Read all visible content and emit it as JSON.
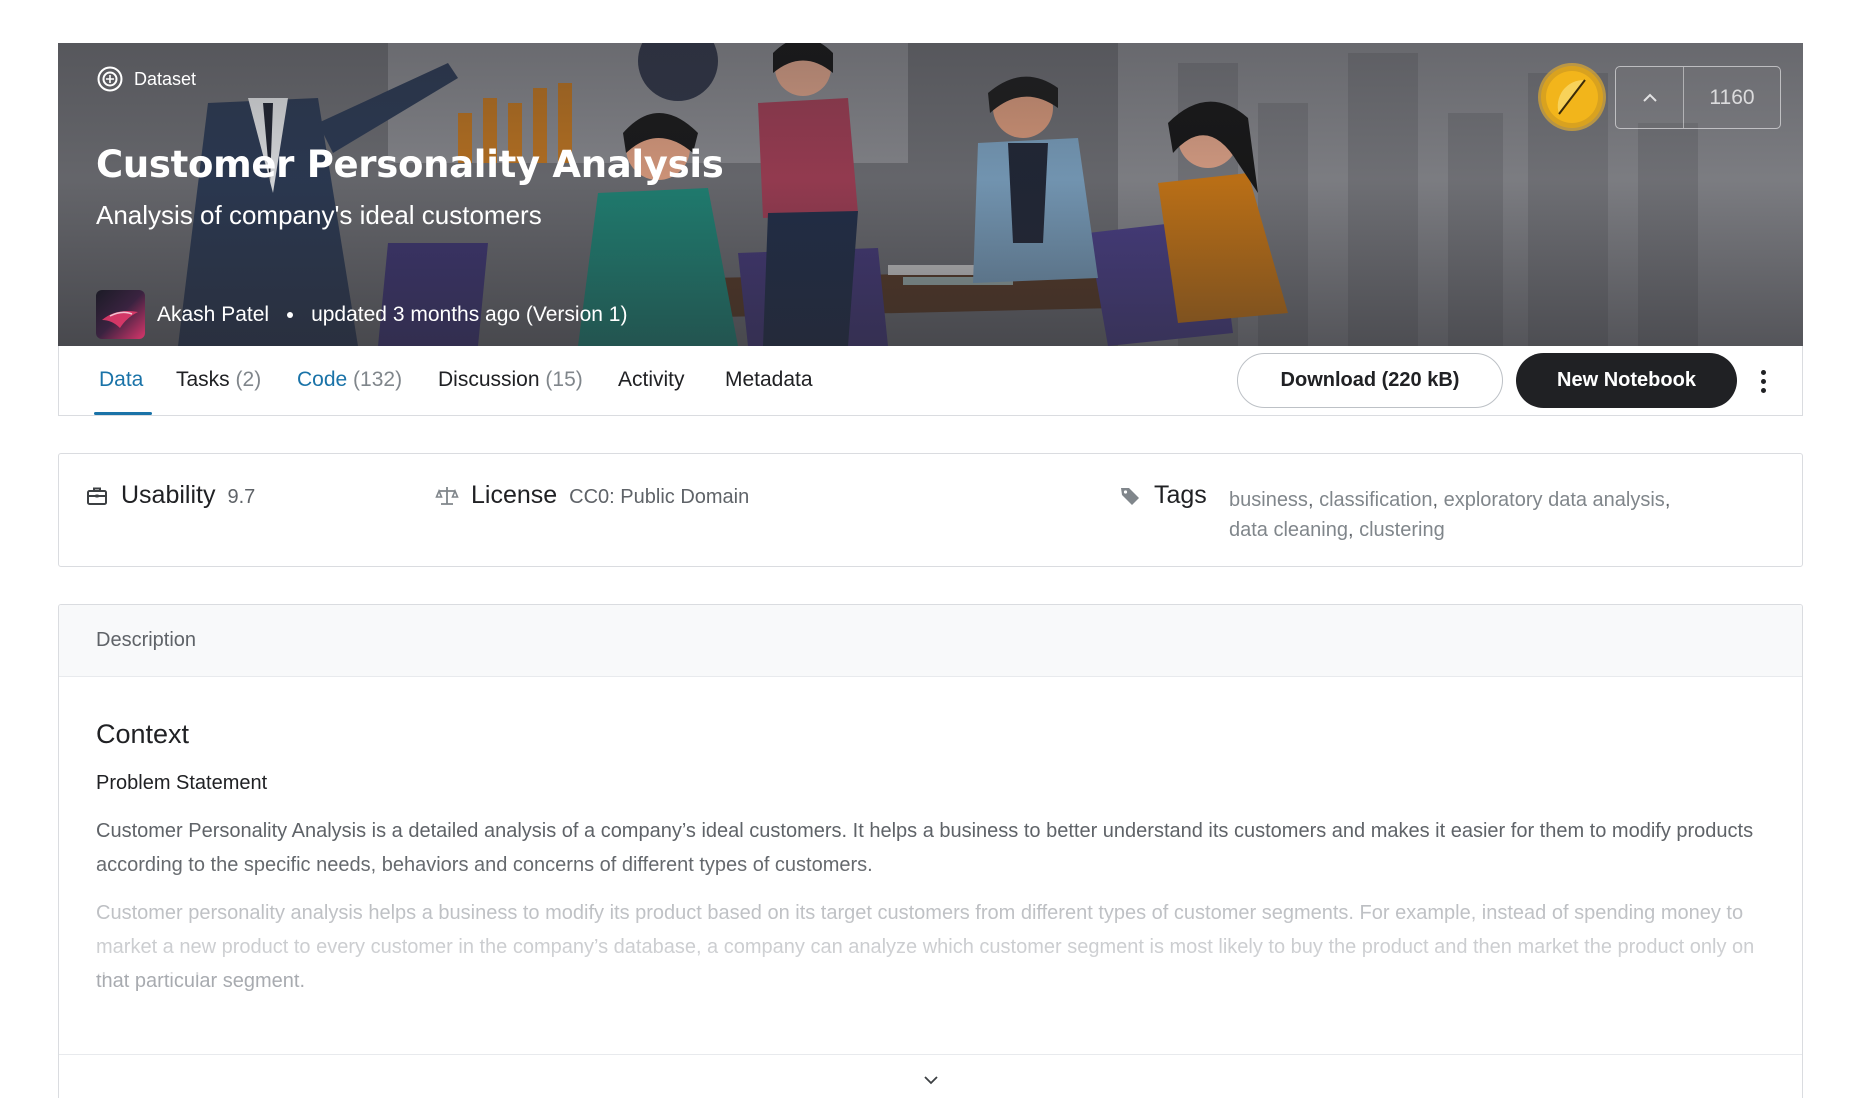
{
  "hero": {
    "type_label": "Dataset",
    "title": "Customer Personality Analysis",
    "subtitle": "Analysis of company's ideal customers",
    "author": "Akash Patel",
    "updated": "updated 3 months ago (Version 1)",
    "upvotes": "1160",
    "icons": {
      "type": "dataset-icon",
      "medal": "gold-medal-icon",
      "upvote": "chevron-up-icon"
    }
  },
  "tabs": [
    {
      "label": "Data",
      "count": "",
      "active": true
    },
    {
      "label": "Tasks",
      "count": "(2)",
      "active": false
    },
    {
      "label": "Code",
      "count": "(132)",
      "active": false
    },
    {
      "label": "Discussion",
      "count": "(15)",
      "active": false
    },
    {
      "label": "Activity",
      "count": "",
      "active": false
    },
    {
      "label": "Metadata",
      "count": "",
      "active": false
    }
  ],
  "actions": {
    "download": "Download (220 kB)",
    "new_notebook": "New Notebook",
    "more_icon": "more-vert-icon"
  },
  "meta": {
    "usability_label": "Usability",
    "usability_value": "9.7",
    "license_label": "License",
    "license_value": "CC0: Public Domain",
    "tags_label": "Tags",
    "tags": [
      "business",
      "classification",
      "exploratory data analysis",
      "data cleaning",
      "clustering"
    ]
  },
  "description": {
    "header": "Description",
    "heading": "Context",
    "subheading": "Problem Statement",
    "paragraph1": "Customer Personality Analysis is a detailed analysis of a company’s ideal customers. It helps a business to better understand its customers and makes it easier for them to modify products according to the specific needs, behaviors and concerns of different types of customers.",
    "paragraph2": "Customer personality analysis helps a business to modify its product based on its target customers from different types of customer segments. For example, instead of spending money to market a new product to every customer in the company’s database, a company can analyze which customer segment is most likely to buy the product and then market the product only on that particular segment."
  },
  "colors": {
    "accent": "#1a73a8",
    "dark_button": "#202124",
    "medal": "#d9a21f"
  }
}
